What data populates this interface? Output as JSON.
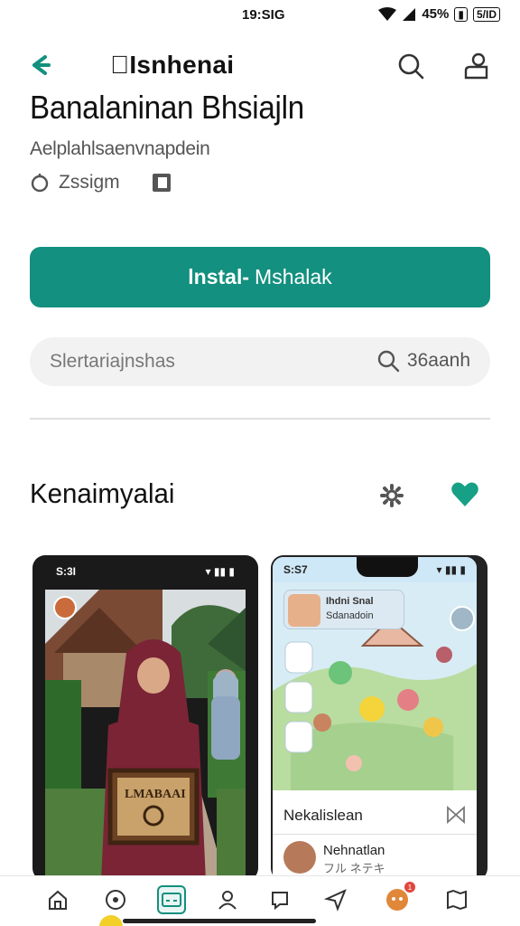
{
  "status_bar": {
    "time": "19:SIG",
    "battery": "45%",
    "battery_box": "5/ID"
  },
  "header": {
    "brand": "Isnhenai"
  },
  "app": {
    "title": "Banalaninan Bhsiajln",
    "subtitle": "Aelplahlsaenvnapdein",
    "meta_value": "Zssigm"
  },
  "install": {
    "label_bold": "lnstal-",
    "label_rest": "Mshalak"
  },
  "search": {
    "placeholder": "Slertariajnshas",
    "right_text": "36aanh"
  },
  "section": {
    "title": "Kenaimyalai"
  },
  "screenshot_a": {
    "time": "S:3I",
    "sign_text": "LMABAAI"
  },
  "screenshot_b": {
    "time": "S:S7",
    "chat_line1": "Ihdni Snal",
    "chat_line2": "Sdanadoin",
    "list_title": "Nekalislean",
    "list_name": "Nehnatlan",
    "list_sub": "フル ネテキ"
  },
  "bottom_nav": {
    "items": [
      "home-icon",
      "compass-icon",
      "apps-icon",
      "profile-icon",
      "chat-icon",
      "send-icon",
      "avatar-icon",
      "map-icon"
    ],
    "active_index": 2,
    "badge": "1"
  },
  "colors": {
    "accent": "#13907f",
    "favorite": "#16a085"
  }
}
